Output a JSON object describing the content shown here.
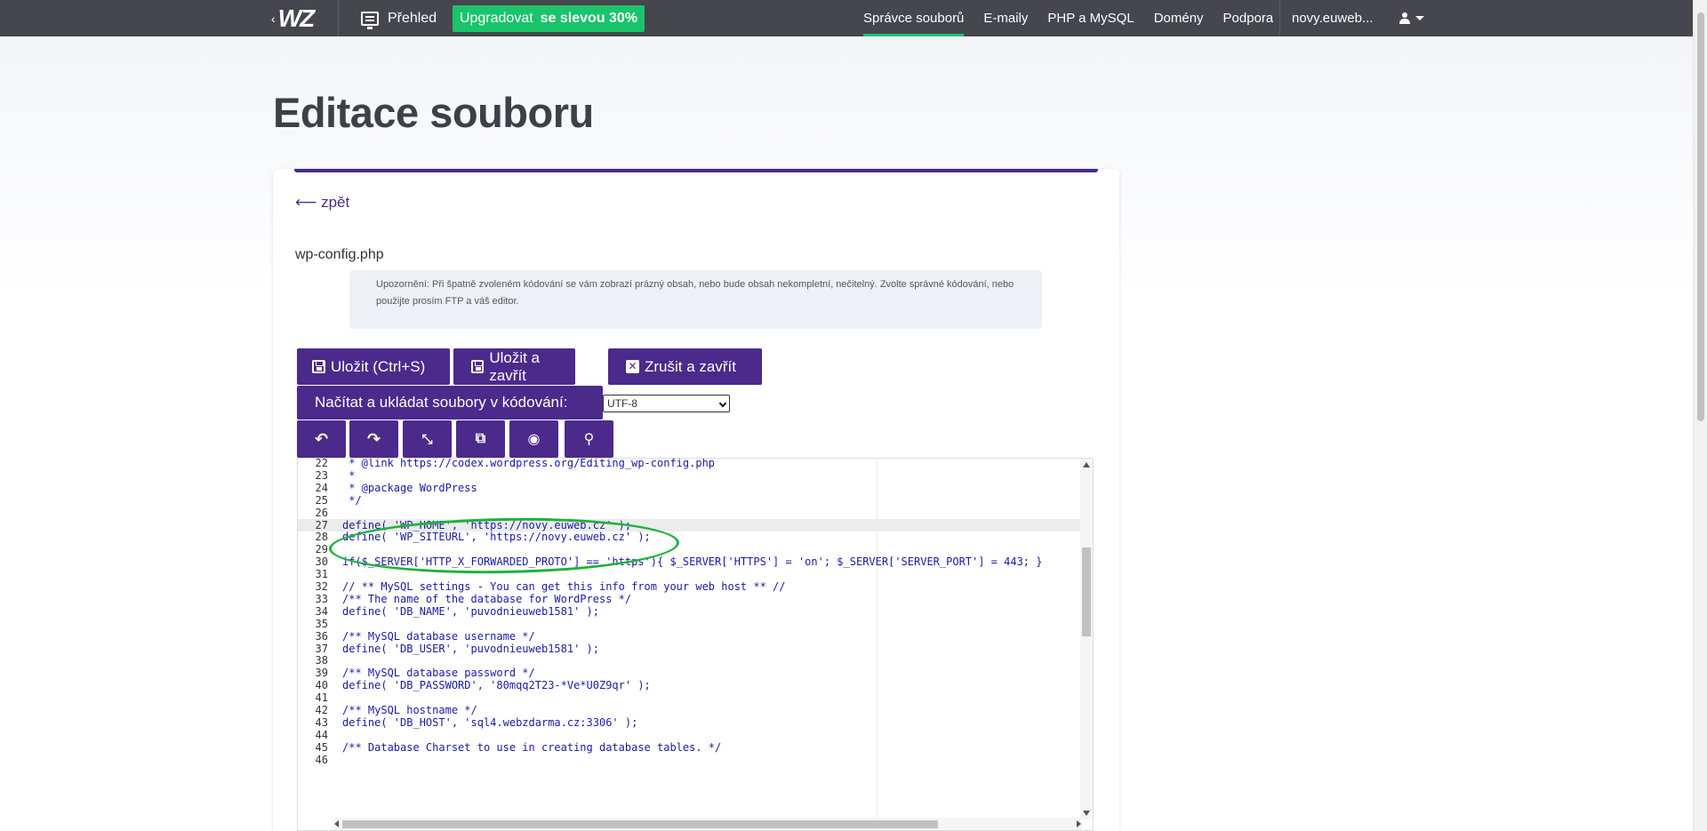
{
  "nav": {
    "logo": "WZ",
    "overview": "Přehled",
    "upgrade_main": "Upgradovat",
    "upgrade_bold": "se slevou 30%",
    "links": [
      "Správce souborů",
      "E-maily",
      "PHP a MySQL",
      "Domény",
      "Podpora"
    ],
    "user": "novy.euweb..."
  },
  "page": {
    "title": "Editace souboru",
    "back": "⟵ zpět",
    "filename": "wp-config.php",
    "warning": "Upozornění: Při špatně zvoleném kódování se vám zobrazí prázný obsah, nebo bude obsah nekompletní, nečitelný. Zvolte správné kódování, nebo použijte prosím FTP a váš editor."
  },
  "buttons": {
    "save": "Uložit (Ctrl+S)",
    "save_close": "Uložit a zavřít",
    "cancel_close": "Zrušit a zavřít",
    "encoding_label": "Načítat a ukládat soubory v kódování:",
    "encoding_value": "UTF-8"
  },
  "tools": [
    "undo-icon",
    "redo-icon",
    "compress-icon",
    "external-link-icon",
    "eye-icon",
    "search-icon"
  ],
  "editor": {
    "lines": [
      {
        "n": "22",
        "t": " * @link https://codex.wordpress.org/Editing_wp-config.php",
        "k": "comment"
      },
      {
        "n": "23",
        "t": " *",
        "k": "comment"
      },
      {
        "n": "24",
        "t": " * @package WordPress",
        "k": "comment"
      },
      {
        "n": "25",
        "t": " */",
        "k": "comment"
      },
      {
        "n": "26",
        "t": "",
        "k": "code"
      },
      {
        "n": "27",
        "t": "define( 'WP_HOME', 'https://novy.euweb.cz' );",
        "k": "code"
      },
      {
        "n": "28",
        "t": "define( 'WP_SITEURL', 'https://novy.euweb.cz' );",
        "k": "code"
      },
      {
        "n": "29",
        "t": "",
        "k": "code"
      },
      {
        "n": "30",
        "t": "if($_SERVER['HTTP_X_FORWARDED_PROTO'] == 'https'){ $_SERVER['HTTPS'] = 'on'; $_SERVER['SERVER_PORT'] = 443; }",
        "k": "code"
      },
      {
        "n": "31",
        "t": "",
        "k": "code"
      },
      {
        "n": "32",
        "t": "// ** MySQL settings - You can get this info from your web host ** //",
        "k": "comment"
      },
      {
        "n": "33",
        "t": "/** The name of the database for WordPress */",
        "k": "comment"
      },
      {
        "n": "34",
        "t": "define( 'DB_NAME', 'puvodnieuweb1581' );",
        "k": "code"
      },
      {
        "n": "35",
        "t": "",
        "k": "code"
      },
      {
        "n": "36",
        "t": "/** MySQL database username */",
        "k": "comment"
      },
      {
        "n": "37",
        "t": "define( 'DB_USER', 'puvodnieuweb1581' );",
        "k": "code"
      },
      {
        "n": "38",
        "t": "",
        "k": "code"
      },
      {
        "n": "39",
        "t": "/** MySQL database password */",
        "k": "comment"
      },
      {
        "n": "40",
        "t": "define( 'DB_PASSWORD', '80mqq2T23-*Ve*U0Z9qr' );",
        "k": "code"
      },
      {
        "n": "41",
        "t": "",
        "k": "code"
      },
      {
        "n": "42",
        "t": "/** MySQL hostname */",
        "k": "comment"
      },
      {
        "n": "43",
        "t": "define( 'DB_HOST', 'sql4.webzdarma.cz:3306' );",
        "k": "code"
      },
      {
        "n": "44",
        "t": "",
        "k": "code"
      },
      {
        "n": "45",
        "t": "/** Database Charset to use in creating database tables. */",
        "k": "comment"
      },
      {
        "n": "46",
        "t": "",
        "k": "code"
      }
    ],
    "highlight_line": "27"
  },
  "colors": {
    "topbar": "#46464e",
    "accent": "#4b2a8c",
    "upgrade": "#19c46b",
    "annotation": "#1db33a"
  }
}
